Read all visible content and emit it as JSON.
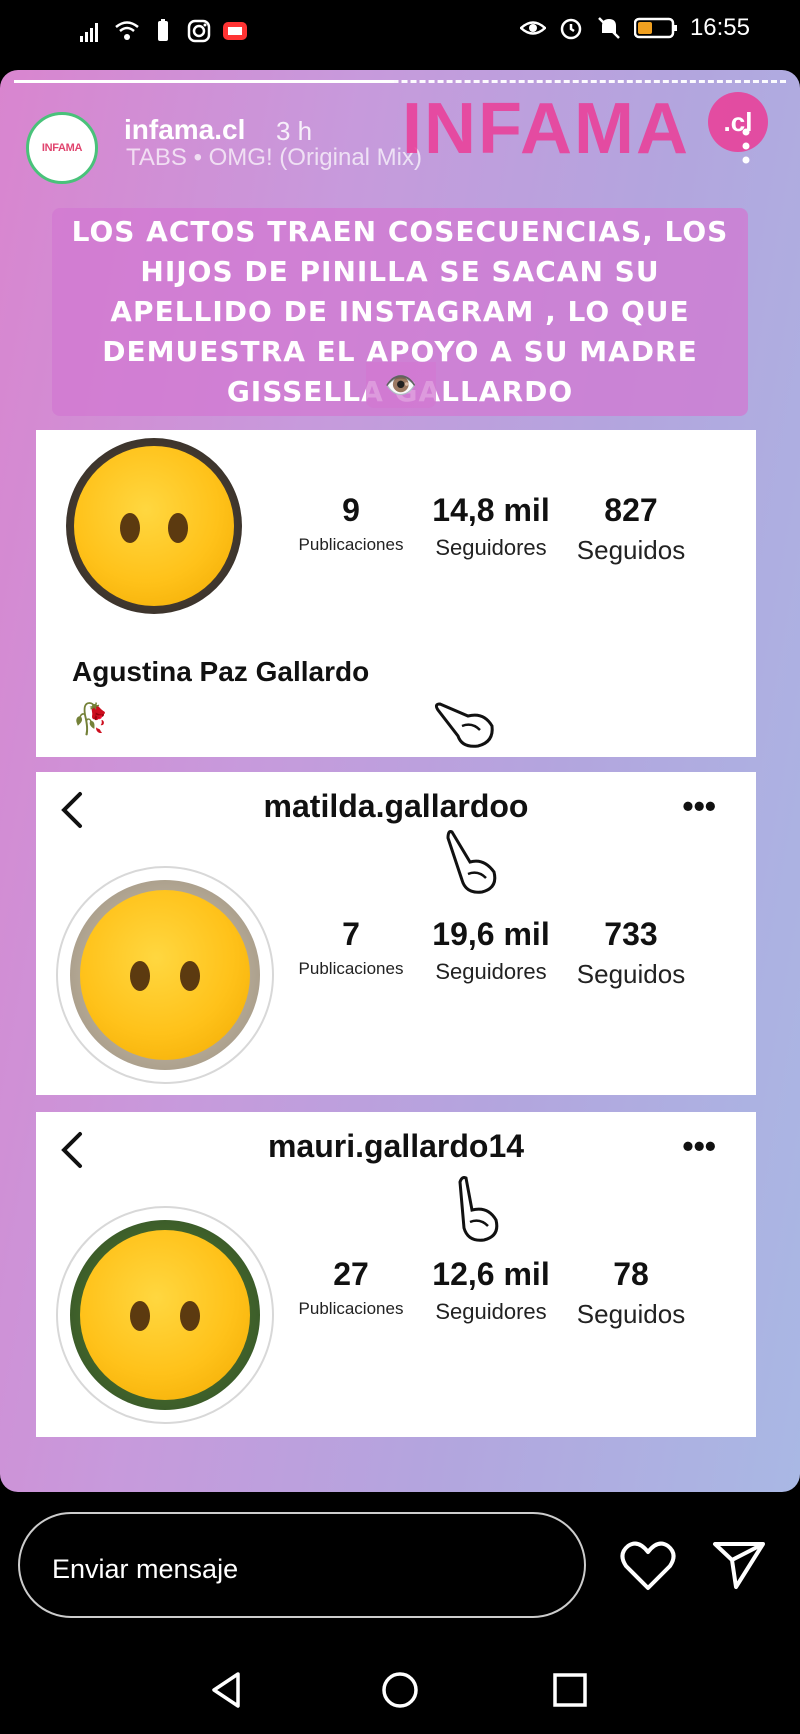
{
  "status_bar": {
    "time": "16:55",
    "left_icons": [
      "signal-icon",
      "wifi-icon",
      "battery-saver-icon",
      "instagram-icon",
      "youtube-icon"
    ],
    "right_icons": [
      "eye-comfort-icon",
      "alarm-icon",
      "mute-icon",
      "battery-icon"
    ]
  },
  "story": {
    "account": {
      "avatar_text": "INFAMA",
      "username": "infama.cl",
      "time_ago": "3 h",
      "music": "TABS • OMG! (Original Mix)"
    },
    "brand": "INFAMA",
    "brand_badge": ".cl",
    "headline": "LOS ACTOS TRAEN COSECUENCIAS, LOS HIJOS DE PINILLA SE SACAN SU APELLIDO DE INSTAGRAM , LO QUE DEMUESTRA EL APOYO A SU MADRE GISSELLA GALLARDO",
    "headline_emoji": "👁️",
    "profiles": [
      {
        "full_name": "Agustina Paz Gallardo",
        "bio_emoji": "🥀",
        "posts": "9",
        "followers": "14,8 mil",
        "following": "827",
        "posts_label": "Publicaciones",
        "followers_label": "Seguidores",
        "following_label": "Seguidos"
      },
      {
        "handle": "matilda.gallardoo",
        "posts": "7",
        "followers": "19,6 mil",
        "following": "733",
        "posts_label": "Publicaciones",
        "followers_label": "Seguidores",
        "following_label": "Seguidos"
      },
      {
        "handle": "mauri.gallardo14",
        "posts": "27",
        "followers": "12,6 mil",
        "following": "78",
        "posts_label": "Publicaciones",
        "followers_label": "Seguidores",
        "following_label": "Seguidos"
      }
    ],
    "more_label": "•••"
  },
  "reply_bar": {
    "placeholder": "Enviar mensaje"
  },
  "nav": {
    "icons": [
      "back-icon",
      "home-icon",
      "recents-icon"
    ]
  },
  "colors": {
    "brand_pink": "#eb3c96",
    "story_gradient_start": "#d985cf",
    "story_gradient_end": "#a9b8e4"
  }
}
